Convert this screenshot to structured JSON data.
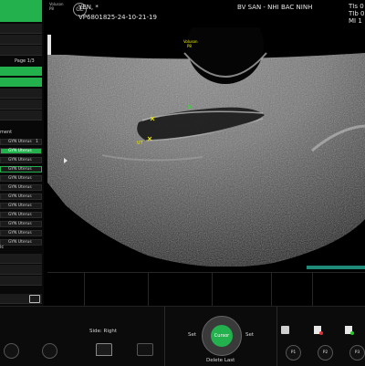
{
  "header": {
    "patient_name": "YEN,  *",
    "patient_id": "VP6801825-24-10-21-19",
    "hospital": "BV SAN - NHI BAC NINH",
    "tis_label": "TIs",
    "tib_label": "TIb",
    "mi_label": "MI",
    "tis_value": "0",
    "tib_value": "0",
    "mi_value": "1",
    "probe_brand": "Voluson",
    "probe_model": "P8"
  },
  "left_panel": {
    "page_label": "Page 1/3",
    "section_label": "ment",
    "section2_label": "ic",
    "items": [
      {
        "label": "GYN Uterus",
        "badge": "1",
        "state": "normal"
      },
      {
        "label": "GYN Uterus",
        "badge": "",
        "state": "active"
      },
      {
        "label": "GYN Uterus",
        "badge": "",
        "state": "normal"
      },
      {
        "label": "GYN Uterus",
        "badge": "",
        "state": "outlined"
      },
      {
        "label": "GYN Uterus",
        "badge": "",
        "state": "normal"
      },
      {
        "label": "GYN Uterus",
        "badge": "",
        "state": "normal"
      },
      {
        "label": "GYN Uterus",
        "badge": "",
        "state": "normal"
      },
      {
        "label": "GYN Uterus",
        "badge": "",
        "state": "normal"
      },
      {
        "label": "GYN Uterus",
        "badge": "",
        "state": "normal"
      },
      {
        "label": "GYN Uterus",
        "badge": "",
        "state": "normal"
      },
      {
        "label": "GYN Uterus",
        "badge": "",
        "state": "normal"
      },
      {
        "label": "GYN Uterus",
        "badge": "",
        "state": "normal"
      }
    ]
  },
  "scan": {
    "watermark_brand": "Voluson",
    "watermark_model": "P8",
    "caliper_label": "UT"
  },
  "bottom": {
    "side_label": "Side: Right",
    "set_left": "Set",
    "set_right": "Set",
    "cursor_label": "Cursor",
    "delete_last": "Delete Last",
    "p1": "P1",
    "p2": "P2",
    "p3": "P3"
  },
  "colors": {
    "accent_green": "#23b14d",
    "caliper_yellow": "#e8e800",
    "caliper_green": "#3dd13d",
    "teal_bar": "#1f8a78"
  }
}
